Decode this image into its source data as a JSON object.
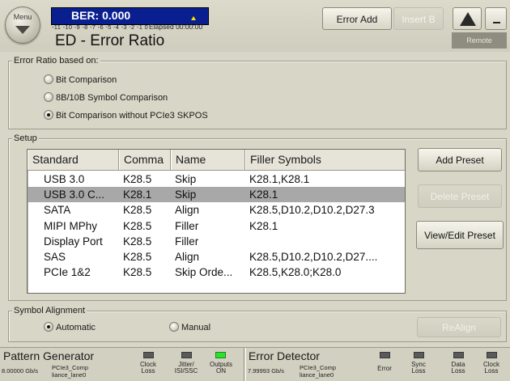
{
  "header": {
    "menu_label": "Menu",
    "ber_label": "BER: 0.000",
    "ber_scale": "-11 -10 -9 -8 -7 -6 -5 -4 -3 -2 -1  0",
    "elapsed": "Elapsed 00:00:00",
    "title": "ED - Error Ratio",
    "error_add": "Error Add",
    "insert_b": "Insert B",
    "remote": "Remote",
    "icons": {
      "menu": "menu-arrow-icon",
      "warning": "warning-icon",
      "minimize": "minimize-icon"
    }
  },
  "error_ratio": {
    "title": "Error Ratio based on:",
    "options": [
      {
        "label": "Bit Comparison",
        "checked": false
      },
      {
        "label": "8B/10B Symbol Comparison",
        "checked": false
      },
      {
        "label": "Bit Comparison without PCIe3 SKPOS",
        "checked": true
      }
    ]
  },
  "setup": {
    "title": "Setup",
    "columns": [
      "Standard",
      "Comma",
      "Name",
      "Filler Symbols"
    ],
    "rows": [
      {
        "standard": "USB 3.0",
        "comma": "K28.5",
        "name": "Skip",
        "filler": "K28.1,K28.1",
        "selected": false
      },
      {
        "standard": "USB 3.0 C...",
        "comma": "K28.1",
        "name": "Skip",
        "filler": "K28.1",
        "selected": true
      },
      {
        "standard": "SATA",
        "comma": "K28.5",
        "name": "Align",
        "filler": "K28.5,D10.2,D10.2,D27.3",
        "selected": false
      },
      {
        "standard": "MIPI MPhy",
        "comma": "K28.5",
        "name": "Filler",
        "filler": "K28.1",
        "selected": false
      },
      {
        "standard": "Display Port",
        "comma": "K28.5",
        "name": "Filler",
        "filler": "",
        "selected": false
      },
      {
        "standard": "SAS",
        "comma": "K28.5",
        "name": "Align",
        "filler": "K28.5,D10.2,D10.2,D27....",
        "selected": false
      },
      {
        "standard": "PCIe 1&2",
        "comma": "K28.5",
        "name": "Skip Orde...",
        "filler": "K28.5,K28.0;K28.0",
        "selected": false
      }
    ],
    "buttons": {
      "add_preset": "Add Preset",
      "delete_preset": "Delete Preset",
      "view_edit_preset": "View/Edit Preset"
    }
  },
  "symbol_alignment": {
    "title": "Symbol Alignment",
    "automatic": "Automatic",
    "manual": "Manual",
    "mode": "automatic",
    "realign": "ReAlign"
  },
  "status": {
    "generator": {
      "title": "Pattern Generator",
      "rate": "8.00000 Gb/s",
      "pattern_l1": "PCIe3_Comp",
      "pattern_l2": "liance_lane0",
      "indicators": [
        {
          "l1": "Clock",
          "l2": "Loss",
          "on": false
        },
        {
          "l1": "Jitter/",
          "l2": "ISI/SSC",
          "on": false
        },
        {
          "l1": "Outputs",
          "l2": "ON",
          "on": true
        }
      ]
    },
    "detector": {
      "title": "Error Detector",
      "rate": "7.99993 Gb/s",
      "pattern_l1": "PCIe3_Comp",
      "pattern_l2": "liance_lane0",
      "indicators": [
        {
          "l1": "Error",
          "l2": "",
          "on": false
        },
        {
          "l1": "Sync",
          "l2": "Loss",
          "on": false
        },
        {
          "l1": "Data",
          "l2": "Loss",
          "on": false
        },
        {
          "l1": "Clock",
          "l2": "Loss",
          "on": false
        }
      ]
    }
  },
  "colors": {
    "ber_bar": "#0a1f8f",
    "selected_row": "#a8a8a8",
    "led_on": "#2ee02e",
    "led_off": "#5a5a5a"
  }
}
